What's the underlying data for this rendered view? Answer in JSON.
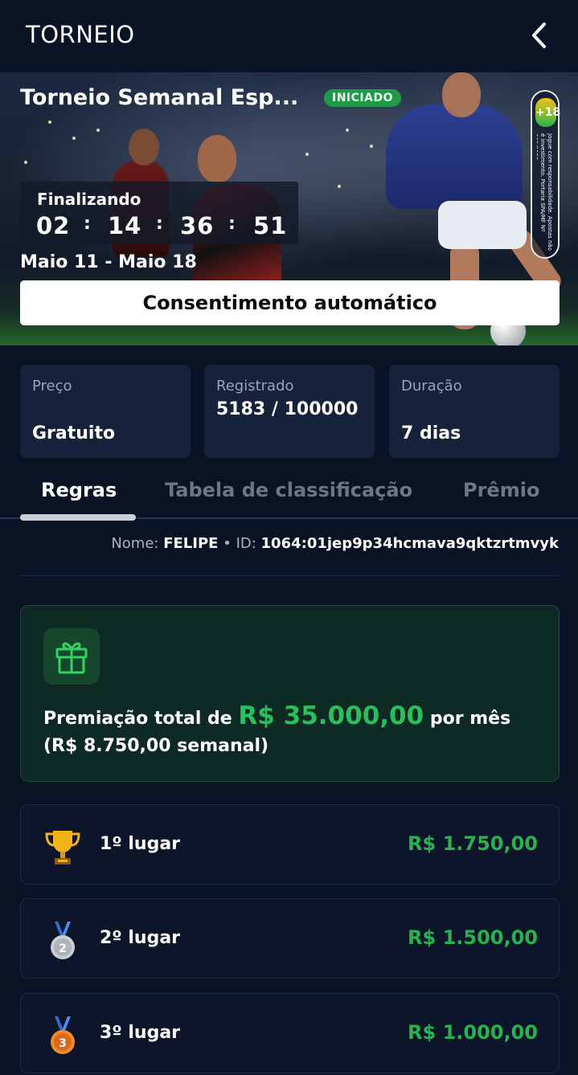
{
  "header": {
    "title": "TORNEIO",
    "back_icon": "chevron-left-icon"
  },
  "banner": {
    "title": "Torneio Semanal Esp...",
    "status": "INICIADO",
    "age_badge": {
      "label": "+18",
      "text": "Jogue com responsabilidade. Apostas não é investimento. Portaria SPA/MF Nº 389/2025"
    },
    "countdown": {
      "label": "Finalizando",
      "days": "02",
      "hours": "14",
      "minutes": "36",
      "seconds": "51",
      "separator": ":"
    },
    "dates": "Maio 11 - Maio 18",
    "consent_button": "Consentimento automático"
  },
  "stats": [
    {
      "label": "Preço",
      "value": "Gratuito"
    },
    {
      "label": "Registrado",
      "value": "5183 / 100000"
    },
    {
      "label": "Duração",
      "value": "7 dias"
    }
  ],
  "tabs": [
    {
      "label": "Regras",
      "active": true
    },
    {
      "label": "Tabela de classificação",
      "active": false
    },
    {
      "label": "Prêmio",
      "active": false
    }
  ],
  "user": {
    "name_label": "Nome:",
    "name": "FELIPE",
    "sep": "•",
    "id_label": "ID:",
    "id": "1064:01jep9p34hcmava9qktzrtmvyk"
  },
  "prize": {
    "icon": "gift-icon",
    "prefix": "Premiação total de",
    "total": "R$ 35.000,00",
    "suffix": "por mês",
    "weekly": "(R$ 8.750,00 semanal)"
  },
  "placements": [
    {
      "place": "1º lugar",
      "amount": "R$ 1.750,00",
      "icon": "trophy-icon"
    },
    {
      "place": "2º lugar",
      "amount": "R$ 1.500,00",
      "icon": "silver-medal-icon"
    },
    {
      "place": "3º lugar",
      "amount": "R$ 1.000,00",
      "icon": "bronze-medal-icon"
    }
  ],
  "colors": {
    "background": "#0a1226",
    "accent_green": "#27c05a",
    "card": "#16223c",
    "status_badge": "#1e9a48"
  }
}
